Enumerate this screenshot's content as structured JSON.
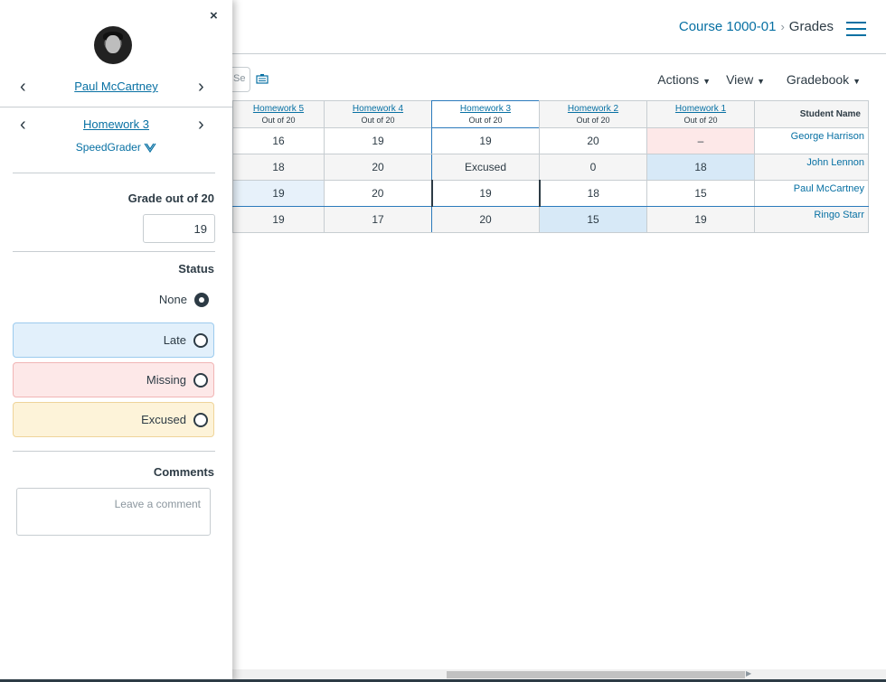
{
  "header": {
    "breadcrumb_course": "Course 1000-01",
    "breadcrumb_sep": "›",
    "breadcrumb_page": "Grades"
  },
  "toolbar": {
    "gradebook_label": "Gradebook",
    "view_label": "View",
    "actions_label": "Actions",
    "caret": "▼",
    "search_placeholder": "Se"
  },
  "grid": {
    "name_header": "Student Name",
    "columns": [
      {
        "title": "Homework 1",
        "outof": "Out of 20"
      },
      {
        "title": "Homework 2",
        "outof": "Out of 20"
      },
      {
        "title": "Homework 3",
        "outof": "Out of 20"
      },
      {
        "title": "Homework 4",
        "outof": "Out of 20"
      },
      {
        "title": "Homework 5",
        "outof": "Out of 20"
      }
    ],
    "rows": [
      {
        "name": "George Harrison",
        "cells": [
          "–",
          "20",
          "19",
          "19",
          "16"
        ]
      },
      {
        "name": "John Lennon",
        "cells": [
          "18",
          "0",
          "Excused",
          "20",
          "18"
        ]
      },
      {
        "name": "Paul McCartney",
        "cells": [
          "15",
          "18",
          "19",
          "20",
          "19"
        ]
      },
      {
        "name": "Ringo Starr",
        "cells": [
          "19",
          "15",
          "20",
          "17",
          "19"
        ]
      }
    ]
  },
  "tray": {
    "close_icon": "×",
    "student_name": "Paul McCartney",
    "assignment_name": "Homework 3",
    "speedgrader_label": "SpeedGrader",
    "grade_label": "Grade out of 20",
    "grade_value": "19",
    "status_label": "Status",
    "status_options": {
      "none": "None",
      "late": "Late",
      "missing": "Missing",
      "excused": "Excused"
    },
    "selected_status": "none",
    "comments_label": "Comments",
    "comment_placeholder": "Leave a comment",
    "prev_arrow": "‹",
    "next_arrow": "›"
  },
  "colors": {
    "link": "#0770a3",
    "late": "#d7e9f7",
    "missing": "#fde8e8",
    "excused": "#fdf3d9"
  }
}
